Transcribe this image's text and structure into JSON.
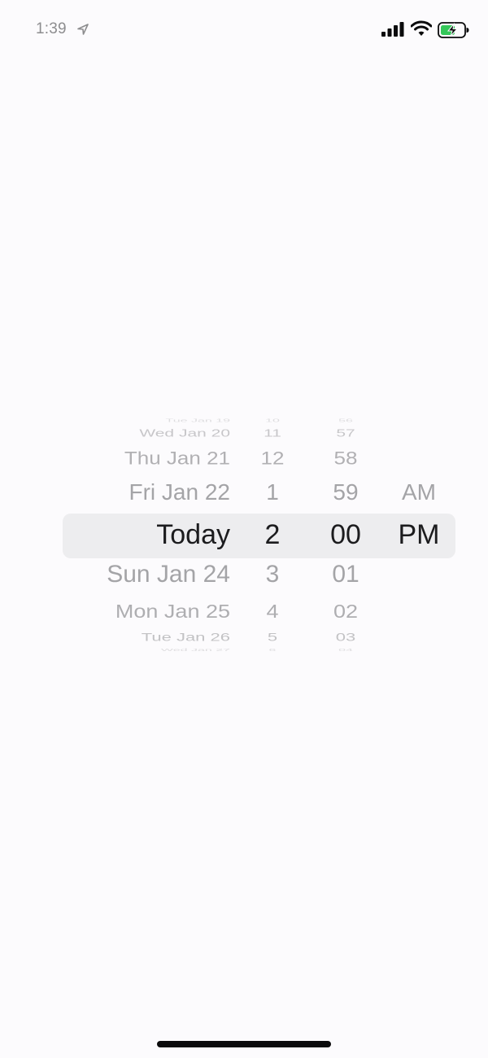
{
  "status_bar": {
    "time": "1:39",
    "icons": [
      "location-arrow-icon",
      "cellular-signal-icon",
      "wifi-icon",
      "battery-charging-icon"
    ],
    "battery_fill_color": "#34c759"
  },
  "picker": {
    "selection_band_color": "#ededef",
    "date_column": {
      "rows": [
        "Tue Jan 19",
        "Wed Jan 20",
        "Thu Jan 21",
        "Fri Jan 22",
        "Today",
        "Sun Jan 24",
        "Mon Jan 25",
        "Tue Jan 26",
        "Wed Jan 27"
      ],
      "selected": "Today"
    },
    "hour_column": {
      "rows": [
        "10",
        "11",
        "12",
        "1",
        "2",
        "3",
        "4",
        "5",
        "6"
      ],
      "selected": "2"
    },
    "minute_column": {
      "rows": [
        "56",
        "57",
        "58",
        "59",
        "00",
        "01",
        "02",
        "03",
        "04"
      ],
      "selected": "00"
    },
    "ampm_column": {
      "rows": [
        "AM",
        "PM"
      ],
      "selected": "PM"
    }
  }
}
